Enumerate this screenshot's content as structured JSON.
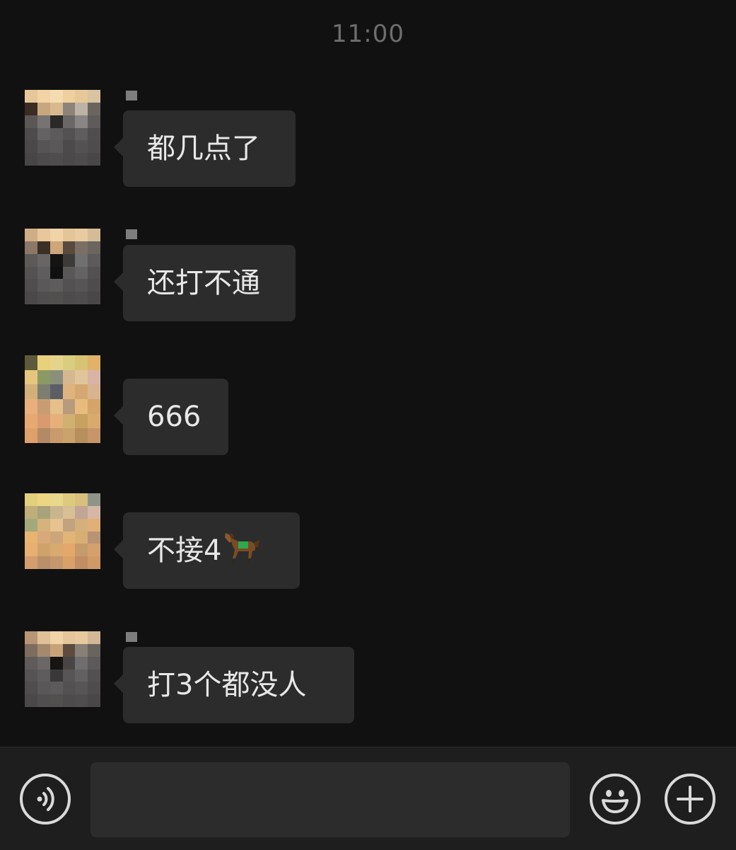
{
  "chat": {
    "timestamp": "11:00",
    "messages": [
      {
        "text": "都几点了",
        "emoji": ""
      },
      {
        "text": "还打不通",
        "emoji": ""
      },
      {
        "text": "666",
        "emoji": ""
      },
      {
        "text": "不接4",
        "emoji": "horse"
      },
      {
        "text": "打3个都没人",
        "emoji": ""
      }
    ]
  },
  "composer": {
    "voice_icon": "voice-icon",
    "emoji_icon": "smiley-icon",
    "more_icon": "plus-icon",
    "input_value": ""
  },
  "colors": {
    "background": "#111111",
    "bubble": "#2c2c2c",
    "text": "#e8e8e8",
    "timestamp": "#6e6e6e",
    "composer_bar": "#1e1e1e"
  }
}
